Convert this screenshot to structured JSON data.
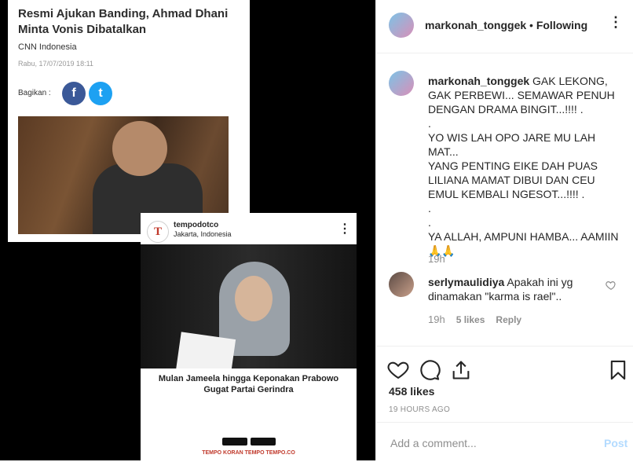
{
  "post_image": {
    "cnn_card": {
      "title": "Resmi Ajukan Banding, Ahmad Dhani Minta Vonis Dibatalkan",
      "source": "CNN Indonesia",
      "date": "Rabu, 17/07/2019 18:11",
      "share_label": "Bagikan :",
      "facebook_glyph": "f",
      "twitter_glyph": "t"
    },
    "tempo_card": {
      "avatar_letter": "T",
      "username": "tempodotco",
      "location": "Jakarta, Indonesia",
      "headline_line1": "Mulan Jameela hingga Keponakan Prabowo",
      "headline_line2": "Gugat Partai Gerindra",
      "footer": "TEMPO   KORAN TEMPO   TEMPO.CO"
    }
  },
  "header": {
    "username": "markonah_tonggek",
    "separator": " • ",
    "follow_status": "Following",
    "more_glyph": "⋮"
  },
  "caption": {
    "username": "markonah_tonggek",
    "lines": [
      "GAK LEKONG,",
      "GAK PERBEWI... SEMAWAR PENUH",
      "DENGAN DRAMA BINGIT...!!!! .",
      ".",
      "YO WIS LAH OPO JARE MU LAH MAT...",
      "YANG PENTING EIKE DAH PUAS",
      "LILIANA MAMAT DIBUI DAN CEU",
      "EMUL KEMBALI NGESOT...!!!! .",
      ".",
      ".",
      "YA ALLAH, AMPUNI HAMBA... AAMIIN",
      "🙏🙏"
    ],
    "time": "19h"
  },
  "comment": {
    "username": "serlymaulidiya",
    "line1": "Apakah ini yg",
    "line2": "dinamakan \"karma is rael\"..",
    "time": "19h",
    "likes": "5 likes",
    "reply": "Reply"
  },
  "actions": {
    "likes": "458 likes",
    "time_ago": "19 HOURS AGO"
  },
  "add_comment": {
    "placeholder": "Add a comment...",
    "post_label": "Post"
  }
}
